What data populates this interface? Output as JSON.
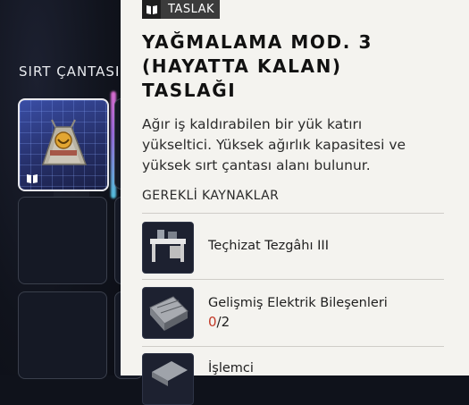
{
  "backpack": {
    "title": "SIRT ÇANTASI"
  },
  "tooltip": {
    "badge_label": "TASLAK",
    "title_lines": [
      "YAĞMALAMA MOD. 3",
      "(HAYATTA KALAN)",
      "TASLAĞI"
    ],
    "description_lines": [
      "Ağır iş kaldırabilen bir yük katırı",
      "yükseltici. Yüksek ağırlık kapasitesi ve",
      "yüksek sırt çantası alanı bulunur."
    ],
    "requirements_header": "GEREKLİ KAYNAKLAR",
    "resources": [
      {
        "name": "Teçhizat Tezgâhı III",
        "icon": "workbench-icon"
      },
      {
        "name": "Gelişmiş Elektrik Bileşenleri",
        "have": "0",
        "need": "/2",
        "icon": "electrical-components-icon"
      },
      {
        "name": "İşlemci",
        "icon": "processor-icon"
      }
    ]
  },
  "colors": {
    "tooltip_bg": "#f4f3ef",
    "badge_bg": "#3b3b3b",
    "insufficient": "#c23a28",
    "selected_slot": "#3a4ea6"
  }
}
